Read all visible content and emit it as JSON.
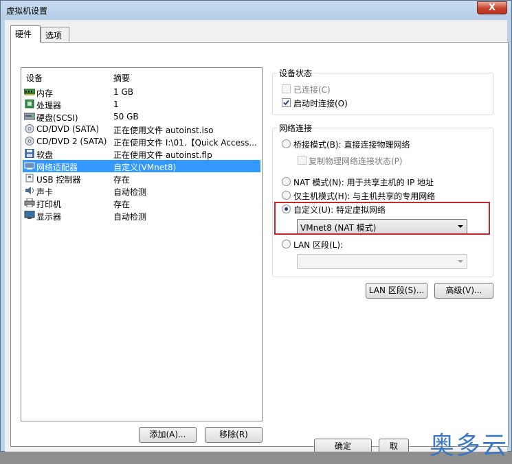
{
  "window": {
    "title": "虚拟机设置",
    "close_label": "X"
  },
  "tabs": [
    {
      "label": "硬件"
    },
    {
      "label": "选项"
    }
  ],
  "device_list": {
    "headers": {
      "device": "设备",
      "summary": "摘要"
    },
    "rows": [
      {
        "name": "内存",
        "summary": "1 GB",
        "icon": "memory-icon"
      },
      {
        "name": "处理器",
        "summary": "1",
        "icon": "processor-icon"
      },
      {
        "name": "硬盘(SCSI)",
        "summary": "50 GB",
        "icon": "hard-disk-icon"
      },
      {
        "name": "CD/DVD (SATA)",
        "summary": "正在使用文件 autoinst.iso",
        "icon": "cd-dvd-icon"
      },
      {
        "name": "CD/DVD 2 (SATA)",
        "summary": "正在使用文件 I:\\01.【Quick Access...",
        "icon": "cd-dvd-icon"
      },
      {
        "name": "软盘",
        "summary": "正在使用文件 autoinst.flp",
        "icon": "floppy-icon"
      },
      {
        "name": "网络适配器",
        "summary": "自定义(VMnet8)",
        "icon": "network-adapter-icon",
        "selected": true
      },
      {
        "name": "USB 控制器",
        "summary": "存在",
        "icon": "usb-icon"
      },
      {
        "name": "声卡",
        "summary": "自动检测",
        "icon": "sound-card-icon"
      },
      {
        "name": "打印机",
        "summary": "存在",
        "icon": "printer-icon"
      },
      {
        "name": "显示器",
        "summary": "自动检测",
        "icon": "display-icon"
      }
    ]
  },
  "buttons": {
    "add": "添加(A)...",
    "remove": "移除(R)",
    "lan_segments": "LAN 区段(S)...",
    "advanced": "高级(V)...",
    "ok": "确定",
    "cancel": "取"
  },
  "device_status": {
    "title": "设备状态",
    "connected": {
      "label": "已连接(C)",
      "checked": false,
      "disabled": true
    },
    "connect_at_power_on": {
      "label": "启动时连接(O)",
      "checked": true
    }
  },
  "network_connection": {
    "title": "网络连接",
    "bridged": "桥接模式(B): 直接连接物理网络",
    "replicate": "复制物理网络连接状态(P)",
    "nat": "NAT 模式(N): 用于共享主机的 IP 地址",
    "host_only": "仅主机模式(H): 与主机共享的专用网络",
    "custom": "自定义(U): 特定虚拟网络",
    "custom_selected": "VMnet8 (NAT 模式)",
    "lan_segment": "LAN 区段(L):",
    "lan_segment_selected": "",
    "selected_option": "custom"
  },
  "watermark": "奥多云",
  "colors": {
    "selection": "#3399ff",
    "highlight_box": "#c8262a",
    "watermark": "#3a78c2"
  }
}
